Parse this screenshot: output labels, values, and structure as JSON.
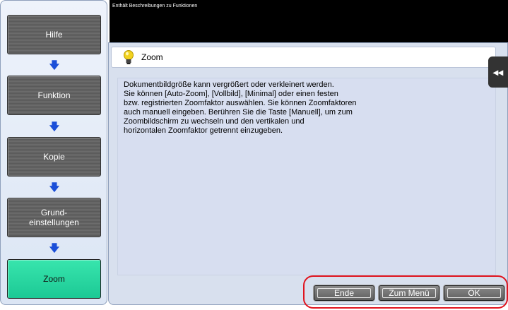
{
  "header": {
    "description_text": "Enthält Beschreibungen zu Funktionen"
  },
  "nav": {
    "items": [
      {
        "label": "Hilfe"
      },
      {
        "label": "Funktion"
      },
      {
        "label": "Kopie"
      },
      {
        "label": "Grund-\neinstellungen"
      },
      {
        "label": "Zoom"
      }
    ],
    "arrow_glyph": "🡇"
  },
  "content": {
    "title": "Zoom",
    "description": "Dokumentbildgröße kann vergrößert oder verkleinert werden.\nSie können [Auto-Zoom], [Vollbild], [Minimal] oder einen festen\nbzw. registrierten Zoomfaktor auswählen. Sie können Zoomfaktoren\nauch manuell eingeben. Berühren Sie die Taste [Manuell], um zum\nZoombildschirm zu wechseln und den vertikalen und\nhorizontalen Zoomfaktor getrennt einzugeben.",
    "side_tab_glyph": "◂◂"
  },
  "actions": {
    "ende": "Ende",
    "zum_menu": "Zum Menü",
    "ok": "OK"
  },
  "colors": {
    "active_nav": "#2bd8a2",
    "nav_arrow": "#1b4fd8",
    "highlight": "#e0141f"
  },
  "icons": {
    "title": "lightbulb-icon",
    "nav_arrow": "arrow-down-icon",
    "side_tab": "double-chevron-left-icon"
  }
}
